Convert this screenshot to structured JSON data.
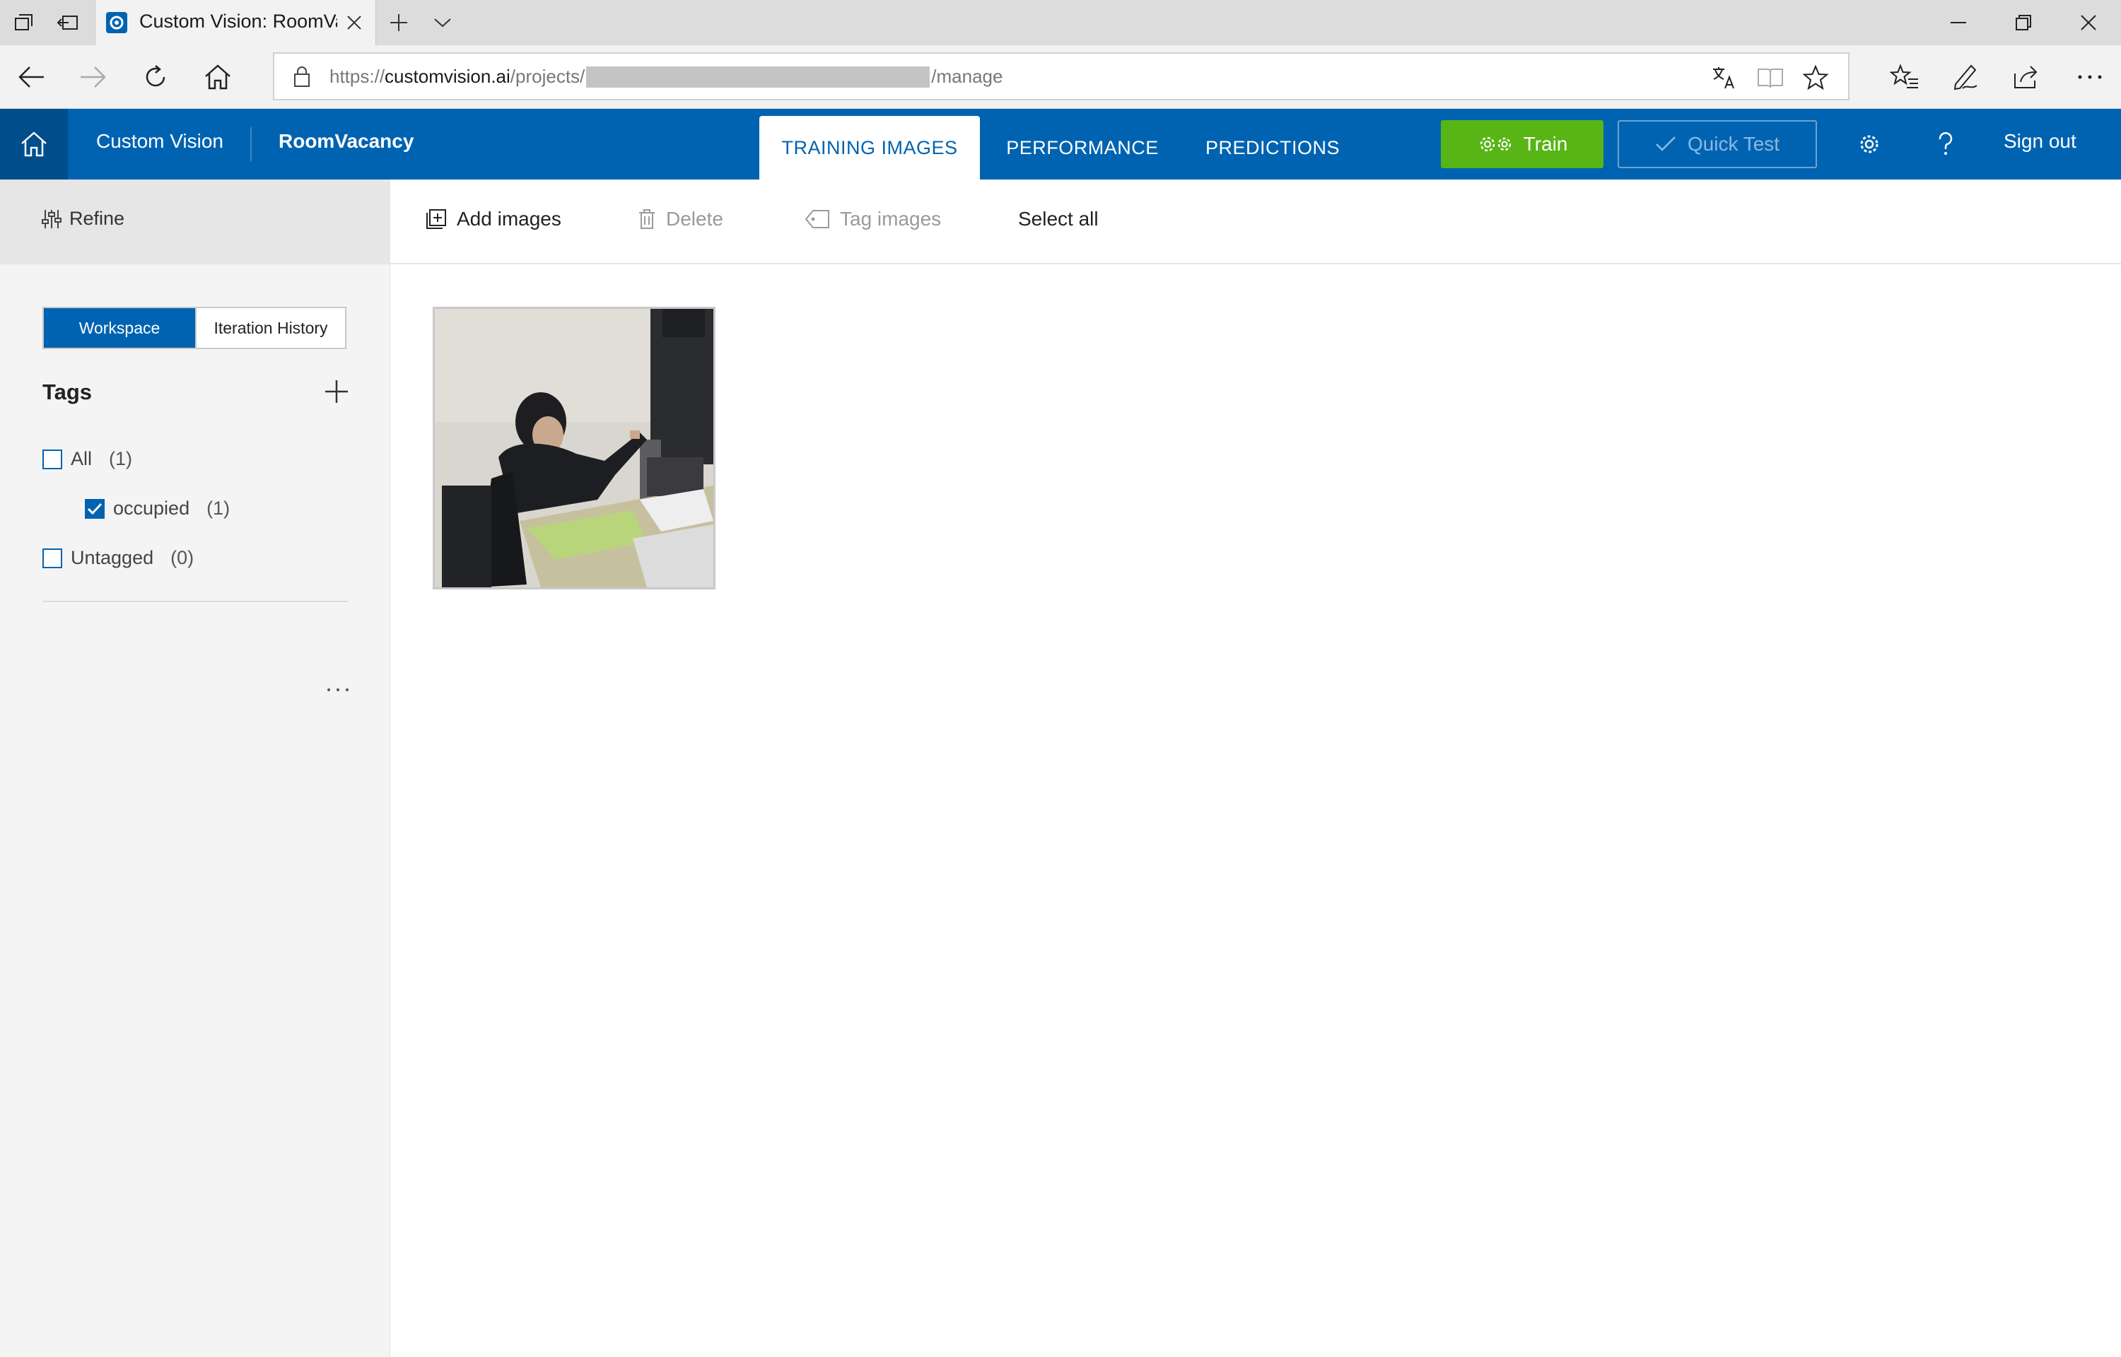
{
  "browser": {
    "tab_title": "Custom Vision: RoomVa",
    "url_prefix": "https://",
    "url_host": "customvision.ai",
    "url_path": "/projects/",
    "url_suffix": "/manage"
  },
  "header": {
    "brand": "Custom Vision",
    "project": "RoomVacancy",
    "tabs": [
      {
        "label": "TRAINING IMAGES",
        "active": true
      },
      {
        "label": "PERFORMANCE",
        "active": false
      },
      {
        "label": "PREDICTIONS",
        "active": false
      }
    ],
    "train_label": "Train",
    "quick_test_label": "Quick Test",
    "sign_out_label": "Sign out"
  },
  "sidebar": {
    "refine_label": "Refine",
    "toggle": {
      "workspace": "Workspace",
      "iteration_history": "Iteration History",
      "selected": "Workspace"
    },
    "tags_title": "Tags",
    "tags": [
      {
        "label": "All",
        "count": "(1)",
        "checked": false
      },
      {
        "label": "occupied",
        "count": "(1)",
        "checked": true
      },
      {
        "label": "Untagged",
        "count": "(0)",
        "checked": false
      }
    ]
  },
  "toolbar": {
    "add_images": "Add images",
    "delete": "Delete",
    "tag_images": "Tag images",
    "select_all": "Select all"
  },
  "images": [
    {
      "tag": "occupied"
    }
  ],
  "colors": {
    "accent": "#0063b1",
    "train": "#57b515",
    "header_home": "#004e8c"
  }
}
